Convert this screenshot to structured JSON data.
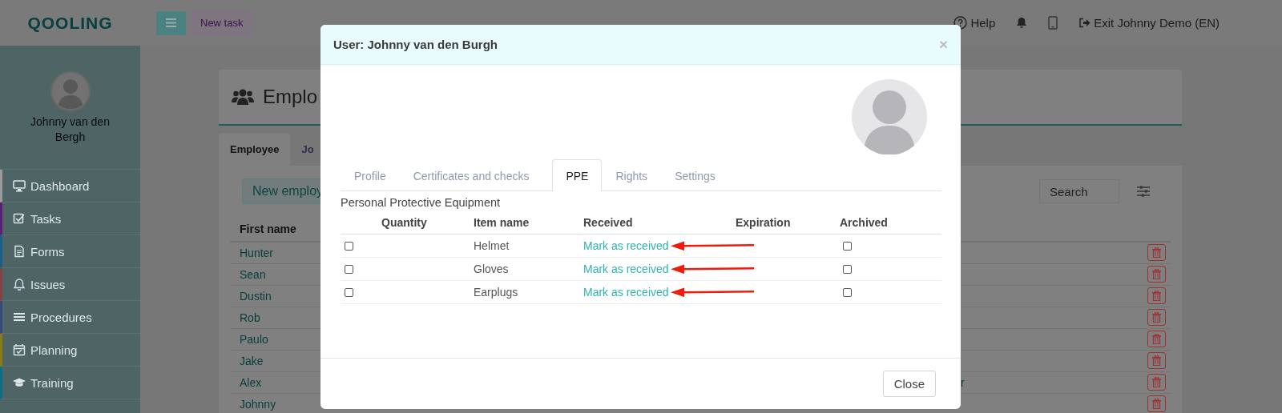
{
  "topbar": {
    "logo": "QOOLING",
    "new_task": "New task",
    "help": "Help",
    "exit": "Exit Johnny Demo (EN)"
  },
  "sidebar": {
    "user_name": "Johnny van den Bergh",
    "items": [
      {
        "label": "Dashboard",
        "kind": "monitor",
        "color": "#9a9a9a"
      },
      {
        "label": "Tasks",
        "kind": "check",
        "color": "#5a2075"
      },
      {
        "label": "Forms",
        "kind": "form",
        "color": "#185f8a"
      },
      {
        "label": "Issues",
        "kind": "bell",
        "color": "#8a4040"
      },
      {
        "label": "Procedures",
        "kind": "list",
        "color": "#344a78"
      },
      {
        "label": "Planning",
        "kind": "calendar",
        "color": "#8a7a10"
      },
      {
        "label": "Training",
        "kind": "cap",
        "color": "#0e6e88"
      }
    ]
  },
  "page": {
    "title": "Emplo",
    "tabs": [
      {
        "label": "Employee",
        "selected": true
      },
      {
        "label": "Jo",
        "selected": false
      }
    ],
    "new_button": "New employ",
    "search": {
      "placeholder": "Search"
    },
    "table": {
      "columns": [
        "First name"
      ],
      "rows": [
        {
          "first_name": "Hunter"
        },
        {
          "first_name": "Sean"
        },
        {
          "first_name": "Dustin"
        },
        {
          "first_name": "Rob"
        },
        {
          "first_name": "Paulo"
        },
        {
          "first_name": "Jake"
        },
        {
          "first_name": "Alex",
          "column_3": "r"
        },
        {
          "first_name": "Johnny"
        }
      ]
    }
  },
  "modal": {
    "title": "User: Johnny van den Burgh",
    "close_x": "×",
    "tabs": [
      {
        "label": "Profile",
        "selected": false
      },
      {
        "label": "Certificates and checks",
        "selected": false
      },
      {
        "label": "PPE",
        "selected": true
      },
      {
        "label": "Rights",
        "selected": false
      },
      {
        "label": "Settings",
        "selected": false
      }
    ],
    "section_title": "Personal Protective Equipment",
    "columns": [
      "Quantity",
      "Item name",
      "Received",
      "Expiration",
      "Archived"
    ],
    "rows": [
      {
        "checked": false,
        "item_name": "Helmet",
        "received": "Mark as received",
        "archived": false,
        "arrow": true
      },
      {
        "checked": false,
        "item_name": "Gloves",
        "received": "Mark as received",
        "archived": false,
        "arrow": true
      },
      {
        "checked": false,
        "item_name": "Earplugs",
        "received": "Mark as received",
        "archived": false,
        "arrow": true
      }
    ],
    "close_button": "Close"
  }
}
